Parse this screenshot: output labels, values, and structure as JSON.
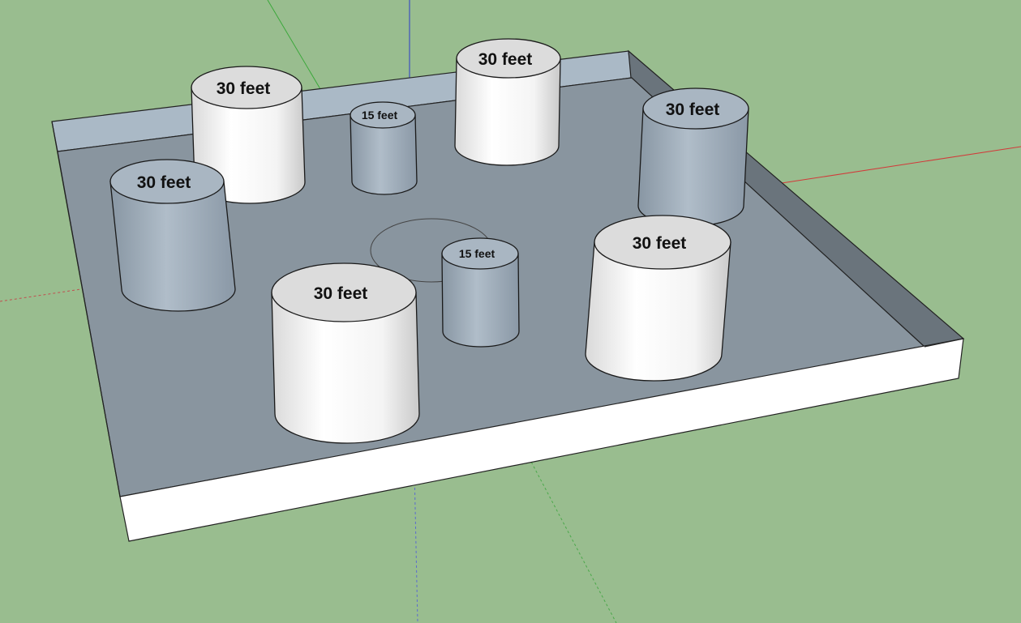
{
  "scene": {
    "background_color": "#99bd8f",
    "axes_colors": {
      "red": "#d23a3a",
      "green": "#3aa83a",
      "blue": "#2c3cc8"
    },
    "pillars": [
      {
        "label": "30 feet",
        "shade": "white"
      },
      {
        "label": "15 feet",
        "shade": "gray"
      },
      {
        "label": "30 feet",
        "shade": "white"
      },
      {
        "label": "30 feet",
        "shade": "gray"
      },
      {
        "label": "30 feet",
        "shade": "gray"
      },
      {
        "label": "15 feet",
        "shade": "gray"
      },
      {
        "label": "30 feet",
        "shade": "white"
      },
      {
        "label": "30 feet",
        "shade": "white"
      }
    ]
  }
}
